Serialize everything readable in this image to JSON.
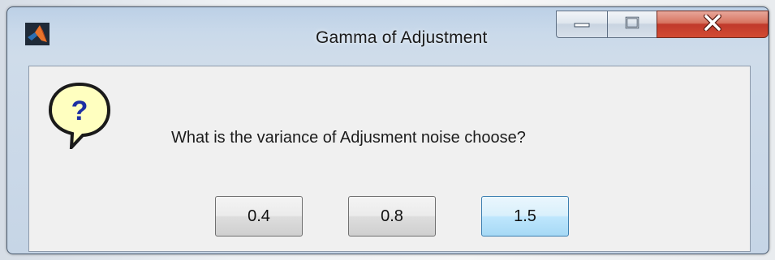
{
  "window": {
    "title": "Gamma of Adjustment",
    "icons": {
      "app": "matlab-logo-icon",
      "question": "question-bubble-icon"
    },
    "controls": {
      "minimize": "minimize-icon",
      "maximize": "maximize-icon",
      "close": "close-icon"
    }
  },
  "dialog": {
    "message": "What is the variance of Adjusment noise choose?",
    "buttons": [
      {
        "label": "0.4"
      },
      {
        "label": "0.8"
      },
      {
        "label": "1.5",
        "focused": true
      }
    ]
  },
  "colors": {
    "close_button": "#c9452f",
    "focused_button": "#bee6fd",
    "dialog_background": "#f0f0f0",
    "question_bubble": "#ffffc0"
  }
}
